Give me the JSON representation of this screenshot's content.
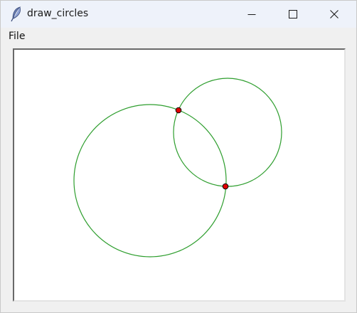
{
  "window": {
    "title": "draw_circles",
    "app_icon": "feather-icon"
  },
  "controls": {
    "minimize_icon": "minimize-icon",
    "maximize_icon": "maximize-icon",
    "close_icon": "close-icon"
  },
  "menu": {
    "items": [
      {
        "label": "File"
      }
    ]
  },
  "canvas": {
    "circle_color": "#2e9e2e",
    "point_fill": "#e00000",
    "point_stroke": "#000000",
    "background": "#ffffff"
  }
}
